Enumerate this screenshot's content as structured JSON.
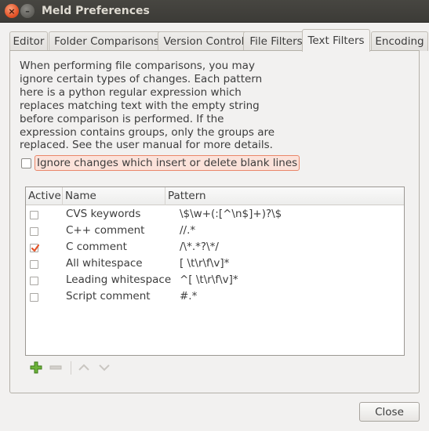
{
  "window": {
    "title": "Meld Preferences",
    "close_glyph": "×",
    "minimize_glyph": "–"
  },
  "tabs": [
    {
      "label": "Editor"
    },
    {
      "label": "Folder Comparisons"
    },
    {
      "label": "Version Control"
    },
    {
      "label": "File Filters"
    },
    {
      "label": "Text Filters",
      "active": true
    },
    {
      "label": "Encoding"
    }
  ],
  "description": "When performing file comparisons, you may ignore certain types of changes. Each pattern here is a python regular expression which replaces matching text with the empty string before comparison is performed. If the expression contains groups, only the groups are replaced. See the user manual for more details.",
  "ignore_blank_lines": {
    "label": "Ignore changes which insert or delete blank lines",
    "checked": false
  },
  "table": {
    "columns": {
      "active": "Active",
      "name": "Name",
      "pattern": "Pattern"
    },
    "rows": [
      {
        "active": false,
        "name": "CVS keywords",
        "pattern": "\\$\\w+(:[^\\n$]+)?\\$"
      },
      {
        "active": false,
        "name": "C++ comment",
        "pattern": "//.*"
      },
      {
        "active": true,
        "name": "C comment",
        "pattern": "/\\*.*?\\*/"
      },
      {
        "active": false,
        "name": "All whitespace",
        "pattern": "[ \\t\\r\\f\\v]*"
      },
      {
        "active": false,
        "name": "Leading whitespace",
        "pattern": "^[ \\t\\r\\f\\v]*"
      },
      {
        "active": false,
        "name": "Script comment",
        "pattern": "#.*"
      }
    ]
  },
  "toolbar": {
    "add_icon": "plus-icon",
    "remove_icon": "minus-icon",
    "move_up_icon": "chevron-up-icon",
    "move_down_icon": "chevron-down-icon"
  },
  "close_button": {
    "label": "Close"
  },
  "colors": {
    "titlebar": "#3c3b37",
    "accent": "#e4552a",
    "add_green": "#5ea32b",
    "background": "#f2f1f0"
  }
}
